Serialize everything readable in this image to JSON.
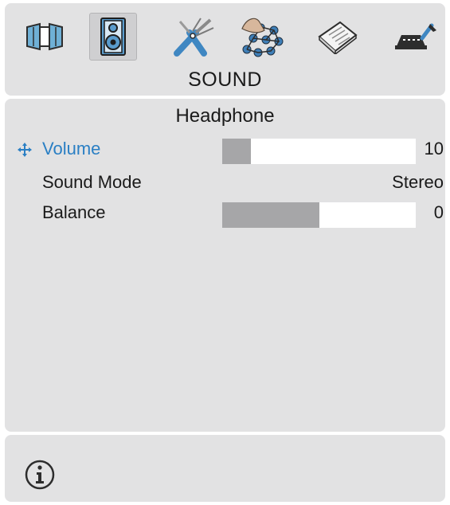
{
  "menu": {
    "title": "SOUND",
    "tabs": [
      {
        "icon": "picture-icon",
        "selected": false
      },
      {
        "icon": "speaker-icon",
        "selected": true
      },
      {
        "icon": "tools-icon",
        "selected": false
      },
      {
        "icon": "network-icon",
        "selected": false
      },
      {
        "icon": "guide-icon",
        "selected": false
      },
      {
        "icon": "support-icon",
        "selected": false
      }
    ]
  },
  "section": {
    "title": "Headphone"
  },
  "settings": [
    {
      "label": "Volume",
      "value": "10",
      "level": 0.15,
      "active": true
    },
    {
      "label": "Sound Mode",
      "value": "Stereo"
    },
    {
      "label": "Balance",
      "value": "0",
      "level": 0.5
    }
  ],
  "footer": {
    "icon": "info-icon"
  },
  "colors": {
    "panel": "#e2e2e3",
    "highlight": "#2a7fc4",
    "slider_fill": "#a6a6a8",
    "slider_track": "#ffffff"
  }
}
